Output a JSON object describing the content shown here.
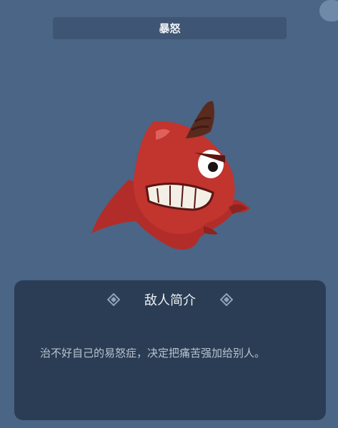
{
  "header": {
    "title": "暴怒"
  },
  "panel": {
    "title": "敌人简介",
    "description": "治不好自己的易怒症，决定把痛苦强加给别人。"
  },
  "icons": {
    "corner": "menu-button-icon",
    "ornament_left": "diamond-ornament-icon",
    "ornament_right": "diamond-ornament-icon",
    "portrait": "angry-red-monster-icon"
  },
  "colors": {
    "background": "#4a6585",
    "title_bar": "#3e5573",
    "panel": "#2b3d54",
    "monster_body": "#c2342e",
    "monster_horn": "#5a2a1f"
  }
}
